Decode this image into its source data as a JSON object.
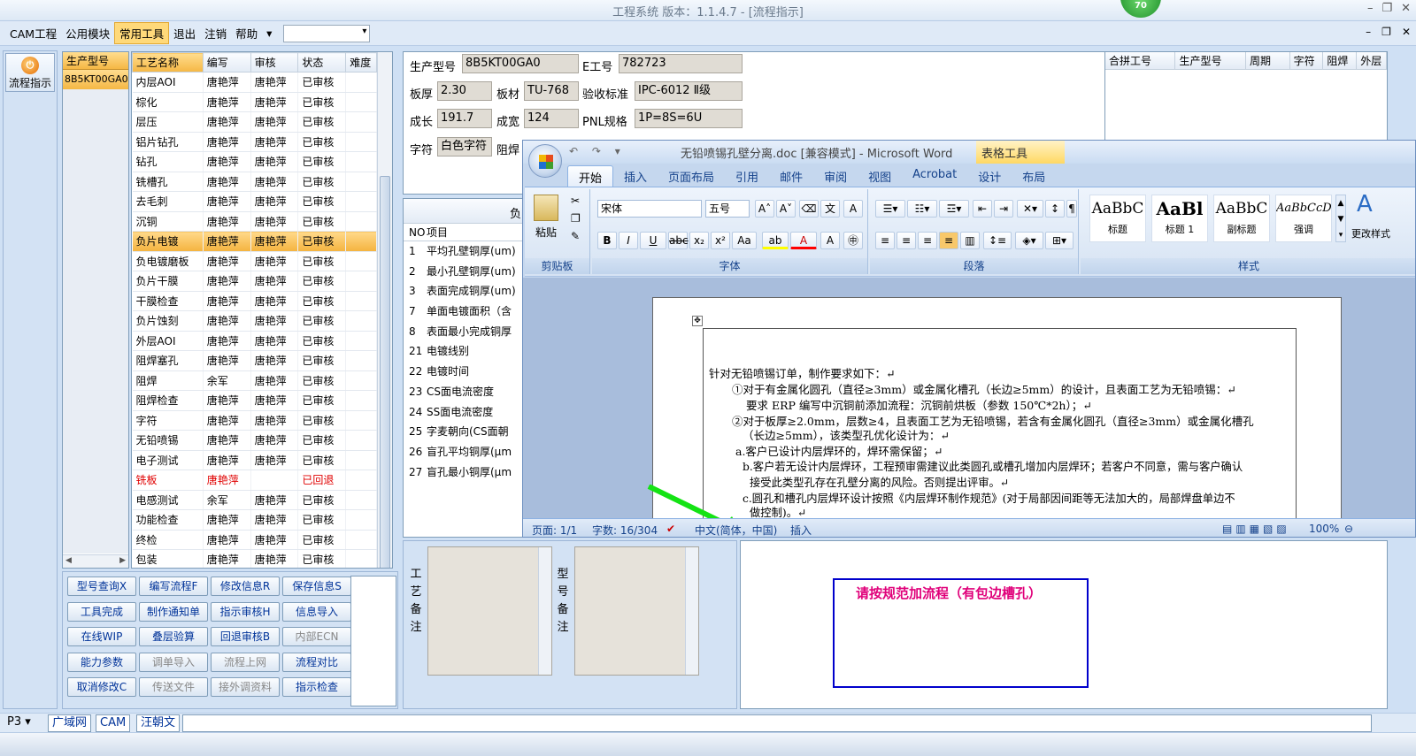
{
  "window": {
    "title": "工程系统  版本：1.1.4.7 - [流程指示]",
    "badge": "70"
  },
  "menu": {
    "items": [
      "CAM工程",
      "公用模块",
      "常用工具",
      "退出",
      "注销",
      "帮助"
    ],
    "active": "常用工具",
    "dropdown": "▾"
  },
  "sidebar": {
    "flow_button": "流程指示"
  },
  "model_list": {
    "header": "生产型号",
    "items": [
      "8B5KT00GA0"
    ]
  },
  "process_table": {
    "headers": [
      "工艺名称",
      "编写",
      "审核",
      "状态",
      "难度"
    ],
    "rows": [
      [
        "内层AOI",
        "唐艳萍",
        "唐艳萍",
        "已审核"
      ],
      [
        "棕化",
        "唐艳萍",
        "唐艳萍",
        "已审核"
      ],
      [
        "层压",
        "唐艳萍",
        "唐艳萍",
        "已审核"
      ],
      [
        "铝片钻孔",
        "唐艳萍",
        "唐艳萍",
        "已审核"
      ],
      [
        "钻孔",
        "唐艳萍",
        "唐艳萍",
        "已审核"
      ],
      [
        "铣槽孔",
        "唐艳萍",
        "唐艳萍",
        "已审核"
      ],
      [
        "去毛刺",
        "唐艳萍",
        "唐艳萍",
        "已审核"
      ],
      [
        "沉铜",
        "唐艳萍",
        "唐艳萍",
        "已审核"
      ],
      [
        "负片电镀",
        "唐艳萍",
        "唐艳萍",
        "已审核"
      ],
      [
        "负电镀磨板",
        "唐艳萍",
        "唐艳萍",
        "已审核"
      ],
      [
        "负片干膜",
        "唐艳萍",
        "唐艳萍",
        "已审核"
      ],
      [
        "干膜检查",
        "唐艳萍",
        "唐艳萍",
        "已审核"
      ],
      [
        "负片蚀刻",
        "唐艳萍",
        "唐艳萍",
        "已审核"
      ],
      [
        "外层AOI",
        "唐艳萍",
        "唐艳萍",
        "已审核"
      ],
      [
        "阻焊塞孔",
        "唐艳萍",
        "唐艳萍",
        "已审核"
      ],
      [
        "阻焊",
        "余军",
        "唐艳萍",
        "已审核"
      ],
      [
        "阻焊检查",
        "唐艳萍",
        "唐艳萍",
        "已审核"
      ],
      [
        "字符",
        "唐艳萍",
        "唐艳萍",
        "已审核"
      ],
      [
        "无铅喷锡",
        "唐艳萍",
        "唐艳萍",
        "已审核"
      ],
      [
        "电子测试",
        "唐艳萍",
        "唐艳萍",
        "已审核"
      ],
      [
        "铣板",
        "唐艳萍",
        "",
        "已回退"
      ],
      [
        "电感测试",
        "余军",
        "唐艳萍",
        "已审核"
      ],
      [
        "功能检查",
        "唐艳萍",
        "唐艳萍",
        "已审核"
      ],
      [
        "终检",
        "唐艳萍",
        "唐艳萍",
        "已审核"
      ],
      [
        "包装",
        "唐艳萍",
        "唐艳萍",
        "已审核"
      ]
    ],
    "selected_row": 8,
    "rejected_row": 20
  },
  "buttons": [
    [
      "型号查询X",
      "编写流程F",
      "修改信息R",
      "保存信息S"
    ],
    [
      "工具完成",
      "制作通知单",
      "指示审核H",
      "信息导入"
    ],
    [
      "在线WIP",
      "叠层验算",
      "回退审核B",
      "内部ECN"
    ],
    [
      "能力参数",
      "调单导入",
      "流程上网",
      "流程对比"
    ],
    [
      "取消修改C",
      "传送文件",
      "接外调资料",
      "指示检查"
    ]
  ],
  "disabled_buttons": [
    "内部ECN",
    "调单导入",
    "流程上网",
    "传送文件",
    "接外调资料"
  ],
  "info": {
    "model_label": "生产型号",
    "model_value": "8B5KT00GA0",
    "e_label": "E工号",
    "e_value": "782723",
    "thick_label": "板厚",
    "thick_value": "2.30",
    "material_label": "板材",
    "material_value": "TU-768",
    "std_label": "验收标准",
    "std_value": "IPC-6012 Ⅱ级",
    "len_label": "成长",
    "len_value": "191.7",
    "wid_label": "成宽",
    "wid_value": "124",
    "pnl_label": "PNL规格",
    "pnl_value": "1P=8S=6U",
    "char_label": "字符",
    "char_value": "白色字符",
    "mask_label": "阻焊"
  },
  "merge_table": {
    "headers": [
      "合拼工号",
      "生产型号",
      "周期",
      "字符",
      "阻焊",
      "外层"
    ]
  },
  "items_table": {
    "title": "负",
    "headers": [
      "NO",
      "项目"
    ],
    "rows": [
      [
        "1",
        "平均孔壁铜厚(um)"
      ],
      [
        "2",
        "最小孔壁铜厚(um)"
      ],
      [
        "3",
        "表面完成铜厚(um)"
      ],
      [
        "7",
        "单面电镀面积（含"
      ],
      [
        "8",
        "表面最小完成铜厚"
      ],
      [
        "21",
        "电镀线别"
      ],
      [
        "22",
        "电镀时间"
      ],
      [
        "23",
        "CS面电流密度"
      ],
      [
        "24",
        "SS面电流密度"
      ],
      [
        "25",
        "字麦朝向(CS面朝"
      ],
      [
        "26",
        "盲孔平均铜厚(μm"
      ],
      [
        "27",
        "盲孔最小铜厚(μm"
      ]
    ]
  },
  "remarks": {
    "process_label": "工艺备注",
    "model_label": "型号备注"
  },
  "note": {
    "text": "请按规范加流程（有包边槽孔）",
    "text_color": "#e0007a",
    "border_color": "#0000cc"
  },
  "statusbar": {
    "page": "P3",
    "tabs": [
      "广域网",
      "CAM",
      "汪朝文"
    ]
  },
  "word": {
    "title": "无铅喷锡孔壁分离.doc [兼容模式] - Microsoft Word",
    "context_tab": "表格工具",
    "tabs": [
      "开始",
      "插入",
      "页面布局",
      "引用",
      "邮件",
      "审阅",
      "视图",
      "Acrobat",
      "设计",
      "布局"
    ],
    "active_tab": "开始",
    "groups": {
      "clipboard": "剪贴板",
      "font": "字体",
      "paragraph": "段落",
      "styles": "样式"
    },
    "paste": "粘贴",
    "font_name": "宋体",
    "font_size": "五号",
    "styles": [
      {
        "sample": "AaBbC",
        "name": "标题"
      },
      {
        "sample": "AaBl",
        "name": "标题 1"
      },
      {
        "sample": "AaBbC",
        "name": "副标题"
      },
      {
        "sample": "AaBbCcD",
        "name": "强调"
      }
    ],
    "change_styles": "更改样式",
    "doc_lines": [
      "针对无铅喷锡订单，制作要求如下：↵",
      "①对于有金属化圆孔（直径≥3mm）或金属化槽孔（长边≥5mm）的设计，且表面工艺为无铅喷锡：↵",
      "要求 ERP 编写中沉铜前添加流程：沉铜前烘板（参数 150℃*2h）；↵",
      "②对于板厚≥2.0mm，层数≥4，且表面工艺为无铅喷锡，若含有金属化圆孔（直径≥3mm）或金属化槽孔",
      "（长边≥5mm），该类型孔优化设计为：↵",
      "a.客户已设计内层焊环的，焊环需保留；↵",
      "b.客户若无设计内层焊环，工程预审需建议此类圆孔或槽孔增加内层焊环；若客户不同意，需与客户确认",
      "接受此类型孔存在孔壁分离的风险。否则提出评审。↵",
      "c.圆孔和槽孔内层焊环设计按照《内层焊环制作规范》(对于局部因间距等无法加大的，局部焊盘单边不",
      "做控制)。↵"
    ],
    "status": {
      "page": "页面: 1/1",
      "words": "字数: 16/304",
      "lang": "中文(简体，中国)",
      "mode": "插入",
      "zoom": "100%"
    }
  }
}
